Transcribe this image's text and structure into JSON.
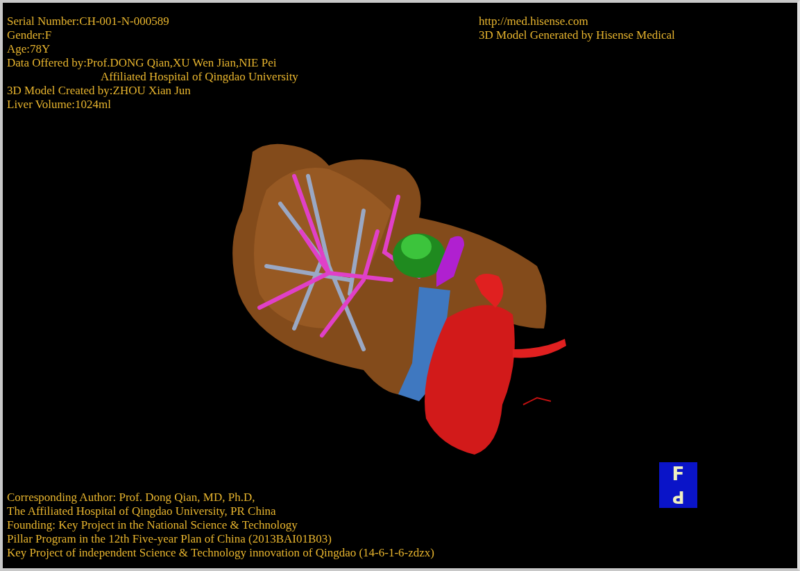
{
  "patient_info": [
    {
      "text": "Serial Number:CH-001-N-000589",
      "kind": "field"
    },
    {
      "text": "Gender:F",
      "kind": "field"
    },
    {
      "text": "Age:78Y",
      "kind": "field"
    },
    {
      "text": "Data Offered by:Prof.DONG Qian,XU Wen Jian,NIE Pei",
      "kind": "field"
    },
    {
      "text": "Affiliated Hospital of Qingdao University",
      "kind": "continuation"
    },
    {
      "text": "3D Model Created by:ZHOU Xian Jun",
      "kind": "field"
    },
    {
      "text": "Liver Volume:1024ml",
      "kind": "field"
    }
  ],
  "vendor_info": [
    "http://med.hisense.com",
    "3D Model Generated by Hisense Medical"
  ],
  "credits": [
    "Corresponding Author: Prof. Dong Qian, MD, Ph.D,",
    "The Affiliated Hospital of Qingdao University, PR China",
    "Founding: Key Project in the National Science & Technology",
    "Pillar Program in the 12th Five-year Plan of China (2013BAI01B03)",
    "Key Project of independent Science & Technology innovation of Qingdao (14-6-1-6-zdzx)"
  ],
  "orientation_cube": {
    "front_face": "F",
    "bottom_face": "P"
  }
}
